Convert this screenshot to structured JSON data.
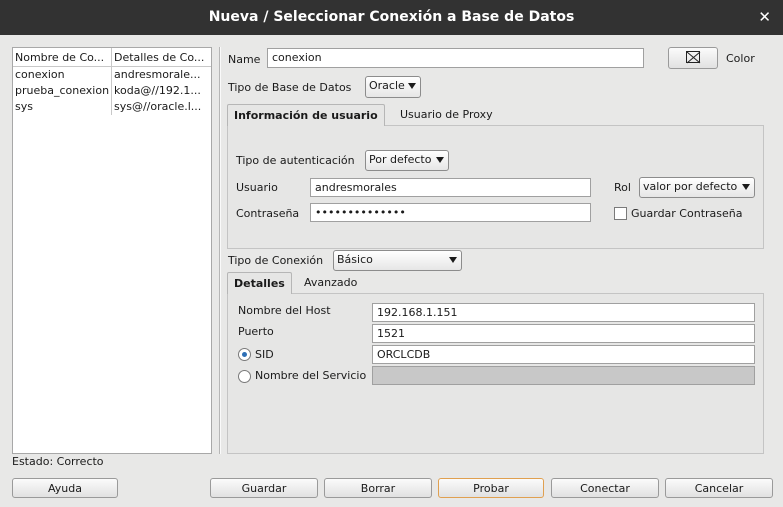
{
  "window": {
    "title": "Nueva / Seleccionar Conexión a Base de Datos",
    "close_glyph": "✕"
  },
  "connections": {
    "columns": [
      "Nombre de Co...",
      "Detalles de Co..."
    ],
    "rows": [
      {
        "name": "conexion",
        "details": "andresmorale..."
      },
      {
        "name": "prueba_conexion",
        "details": "koda@//192.1..."
      },
      {
        "name": "sys",
        "details": "sys@//oracle.l..."
      }
    ]
  },
  "form": {
    "name_label": "Name",
    "name_value": "conexion",
    "color_label": "Color",
    "db_type_label": "Tipo de Base de Datos",
    "db_type_value": "Oracle",
    "tabs": [
      "Información de usuario",
      "Usuario de Proxy"
    ],
    "auth_type_label": "Tipo de autenticación",
    "auth_type_value": "Por defecto",
    "user_label": "Usuario",
    "user_value": "andresmorales",
    "password_label": "Contraseña",
    "password_value": "••••••••••••••",
    "role_label": "Rol",
    "role_value": "valor por defecto",
    "save_password_label": "Guardar Contraseña",
    "conn_type_label": "Tipo de Conexión",
    "conn_type_value": "Básico",
    "conn_tabs": [
      "Detalles",
      "Avanzado"
    ],
    "host_label": "Nombre del Host",
    "host_value": "192.168.1.151",
    "port_label": "Puerto",
    "port_value": "1521",
    "sid_label": "SID",
    "sid_value": "ORCLCDB",
    "service_label": "Nombre del Servicio",
    "service_value": ""
  },
  "status": {
    "text": "Estado: Correcto"
  },
  "buttons": {
    "help": "Ayuda",
    "save": "Guardar",
    "delete": "Borrar",
    "test": "Probar",
    "connect": "Conectar",
    "cancel": "Cancelar"
  },
  "colors": {
    "titlebar": "#323232",
    "focus_border": "#e0a050",
    "radio_dot": "#2d6fb6"
  }
}
